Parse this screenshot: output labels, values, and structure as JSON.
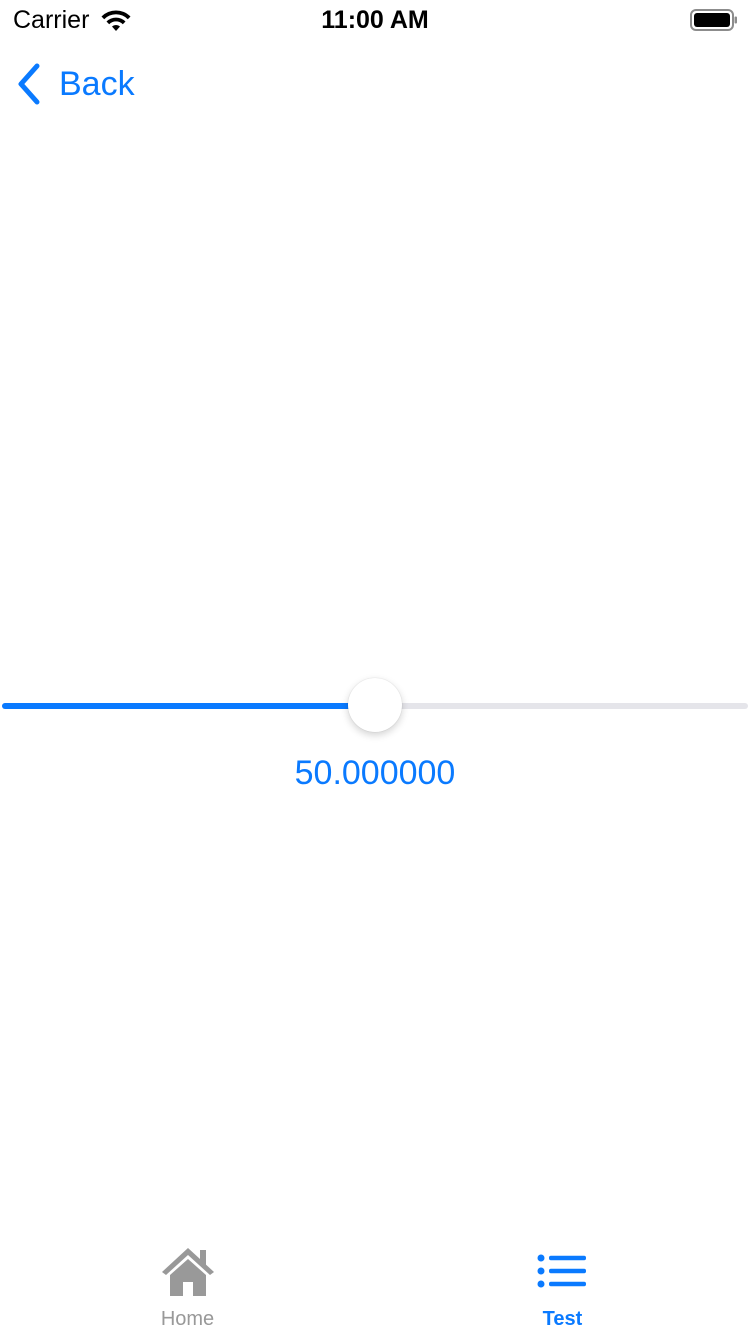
{
  "status_bar": {
    "carrier": "Carrier",
    "time": "11:00 AM",
    "wifi_icon": "wifi-icon",
    "battery_icon": "battery-icon"
  },
  "nav": {
    "back_label": "Back",
    "back_icon": "chevron-left-icon"
  },
  "slider": {
    "value": 50,
    "min": 0,
    "max": 100,
    "value_text": "50.000000"
  },
  "tabs": [
    {
      "label": "Home",
      "icon": "house-icon",
      "active": false
    },
    {
      "label": "Test",
      "icon": "list-icon",
      "active": true
    }
  ],
  "colors": {
    "accent": "#0a7aff",
    "track": "#e5e5ea",
    "inactive_tab": "#999999"
  }
}
